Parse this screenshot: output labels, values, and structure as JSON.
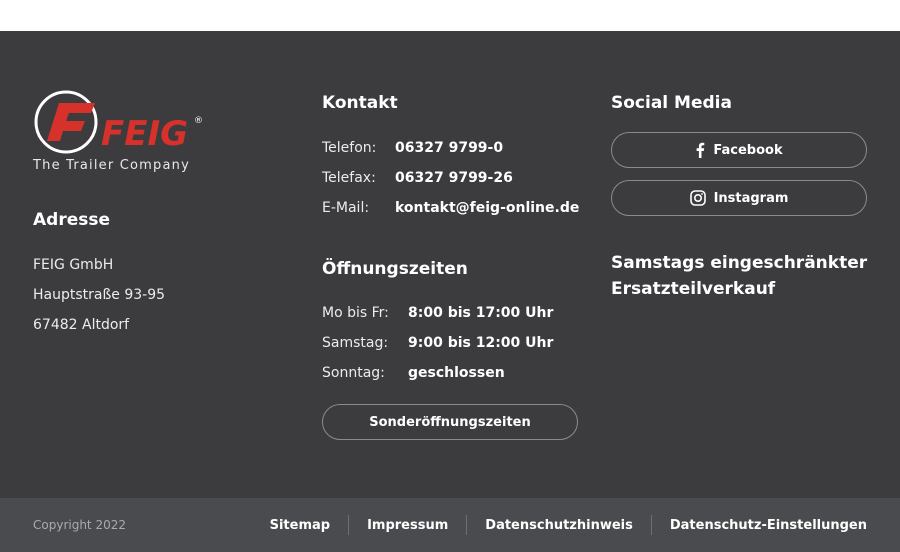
{
  "logo": {
    "text": "FEIG",
    "tagline": "The Trailer Company",
    "registered": "®",
    "brand_color": "#d6312b"
  },
  "adresse": {
    "heading": "Adresse",
    "lines": [
      "FEIG GmbH",
      "Hauptstraße 93-95",
      "67482 Altdorf"
    ]
  },
  "kontakt": {
    "heading": "Kontakt",
    "rows": [
      {
        "label": "Telefon:",
        "value": "06327 9799-0"
      },
      {
        "label": "Telefax:",
        "value": "06327 9799-26"
      },
      {
        "label": "E-Mail:",
        "value": "kontakt@feig-online.de"
      }
    ]
  },
  "oeffnungszeiten": {
    "heading": "Öffnungszeiten",
    "rows": [
      {
        "label": "Mo bis Fr:",
        "value": "8:00 bis 17:00 Uhr"
      },
      {
        "label": "Samstag:",
        "value": "9:00 bis 12:00 Uhr"
      },
      {
        "label": "Sonntag:",
        "value": "geschlossen"
      }
    ],
    "button_label": "Sonderöffnungszeiten"
  },
  "social": {
    "heading": "Social Media",
    "facebook_label": "Facebook",
    "instagram_label": "Instagram",
    "facebook_icon": "facebook-icon",
    "instagram_icon": "instagram-icon"
  },
  "notice": "Samstags eingeschränkter Ersatzteilverkauf",
  "bottom": {
    "copyright": "Copyright 2022",
    "links": [
      "Sitemap",
      "Impressum",
      "Datenschutzhinweis",
      "Datenschutz-Einstellungen"
    ]
  },
  "colors": {
    "footer_bg": "#3c3c3f",
    "bottom_bg": "#4a4b4e",
    "text": "#ffffff"
  }
}
